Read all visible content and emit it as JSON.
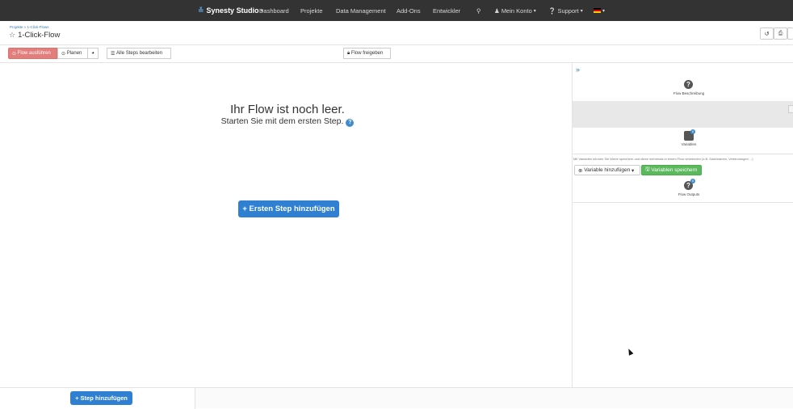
{
  "nav": {
    "brand": "Synesty Studio",
    "items": [
      {
        "label": "Dashboard"
      },
      {
        "label": "Projekte"
      },
      {
        "label": "Data Management"
      },
      {
        "label": "Add-Ons"
      },
      {
        "label": "Entwickler"
      }
    ],
    "account": "Mein Konto",
    "support": "Support"
  },
  "header": {
    "breadcrumb": "Projekte » 1-Click-Flows",
    "title": "1-Click-Flow"
  },
  "toolbar": {
    "run": "Flow ausführen",
    "plan": "Planen",
    "edit_all": "Alle Steps bearbeiten",
    "share": "Flow freigeben"
  },
  "main": {
    "empty_title": "Ihr Flow ist noch leer.",
    "empty_sub": "Starten Sie mit dem ersten Step.",
    "add_first": "+ Ersten Step hinzufügen"
  },
  "panel": {
    "description_label": "Flow Beschreibung",
    "variables_label": "Variablen",
    "variables_count": "0",
    "variables_note": "Mit Variablen können Sie Werte speichern und diese mehrmals in einem Flow verwenden (z.B. Dateinamen, Verbindungen ...)",
    "add_variable": "Variable hinzufügen",
    "save_variables": "Variablen speichern",
    "outputs_label": "Flow Outputs",
    "outputs_count": "0"
  },
  "bottom": {
    "add_step": "+ Step hinzufügen"
  },
  "colors": {
    "nav_bg": "#333333",
    "primary": "#2f80d3",
    "danger": "#d9534f",
    "success": "#5cb85c"
  }
}
